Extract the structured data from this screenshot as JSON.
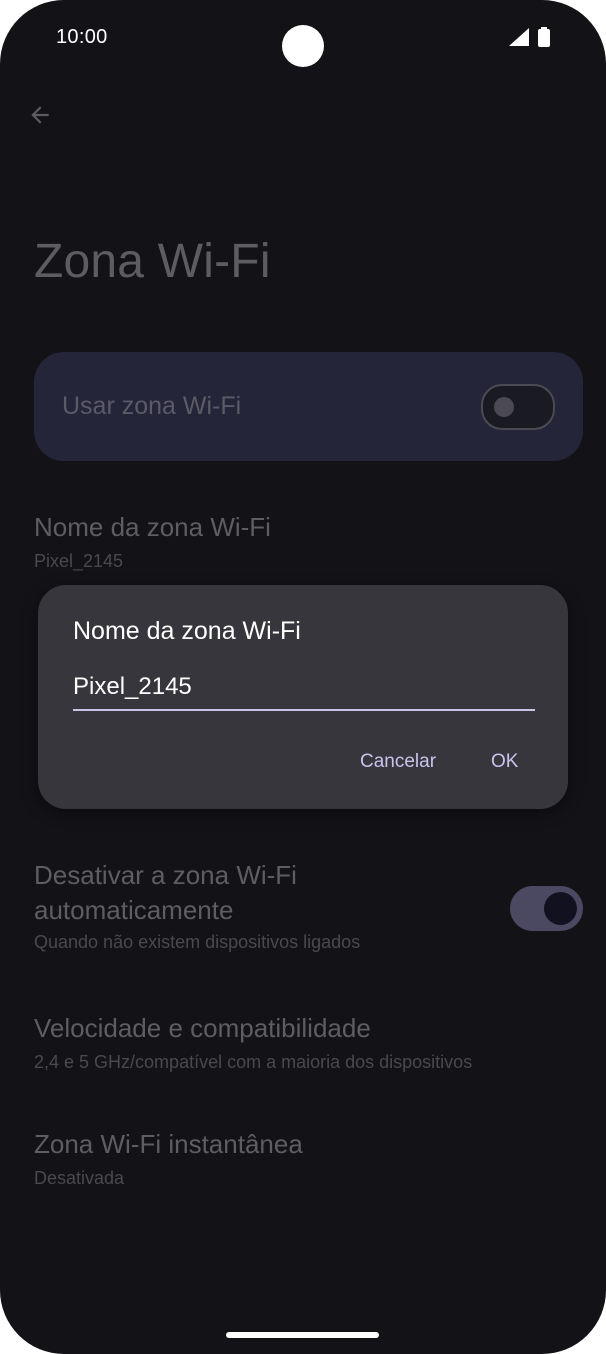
{
  "status_bar": {
    "time": "10:00",
    "signal_icon": "signal-icon",
    "battery_icon": "battery-icon"
  },
  "toolbar": {
    "back_icon": "arrow-back-icon"
  },
  "page": {
    "title": "Zona Wi-Fi"
  },
  "main_switch": {
    "label": "Usar zona Wi-Fi",
    "state": "off"
  },
  "settings": [
    {
      "title": "Nome da zona Wi-Fi",
      "subtitle": "Pixel_2145"
    },
    {
      "title": "Desativar a zona Wi-Fi automaticamente",
      "title_line1": "Desativar a zona Wi-Fi",
      "title_line2": "automaticamente",
      "subtitle": "Quando não existem dispositivos ligados",
      "toggle_state": "on"
    },
    {
      "title": "Velocidade e compatibilidade",
      "subtitle": "2,4 e 5 GHz/compatível com a maioria dos dispositivos"
    },
    {
      "title": "Zona Wi-Fi instantânea",
      "subtitle": "Desativada"
    }
  ],
  "dialog": {
    "title": "Nome da zona Wi-Fi",
    "input_value": "Pixel_2145",
    "cancel_label": "Cancelar",
    "ok_label": "OK"
  },
  "colors": {
    "background": "#131217",
    "dialog_bg": "#37363c",
    "accent": "#c7c3ec",
    "switch_card": "#25253a"
  }
}
